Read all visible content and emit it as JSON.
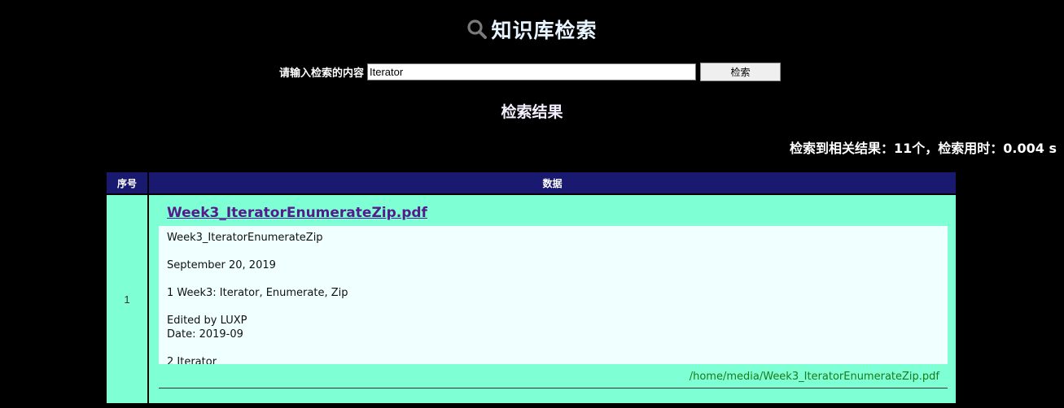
{
  "header": {
    "title": "知识库检索",
    "icon": "search-icon"
  },
  "search": {
    "label": "请输入检索的内容",
    "value": "Iterator",
    "button_label": "检索"
  },
  "results": {
    "heading": "检索结果",
    "stats": "检索到相关结果：11个，检索用时：0.004 s",
    "columns": [
      "序号",
      "数据"
    ],
    "rows": [
      {
        "index": "1",
        "title": "Week3_IteratorEnumerateZip.pdf",
        "snippet": [
          "Week3_IteratorEnumerateZip",
          "September 20, 2019",
          "1 Week3: Iterator, Enumerate, Zip",
          "Edited by LUXP",
          "Date: 2019-09",
          "2 Iterator"
        ],
        "path": "/home/media/Week3_IteratorEnumerateZip.pdf"
      }
    ]
  },
  "colors": {
    "background": "#000000",
    "table_header": "#191970",
    "row_background": "#7fffd4",
    "snippet_background": "#f0ffff",
    "link": "#551a8b",
    "path": "#1a7a1a"
  }
}
